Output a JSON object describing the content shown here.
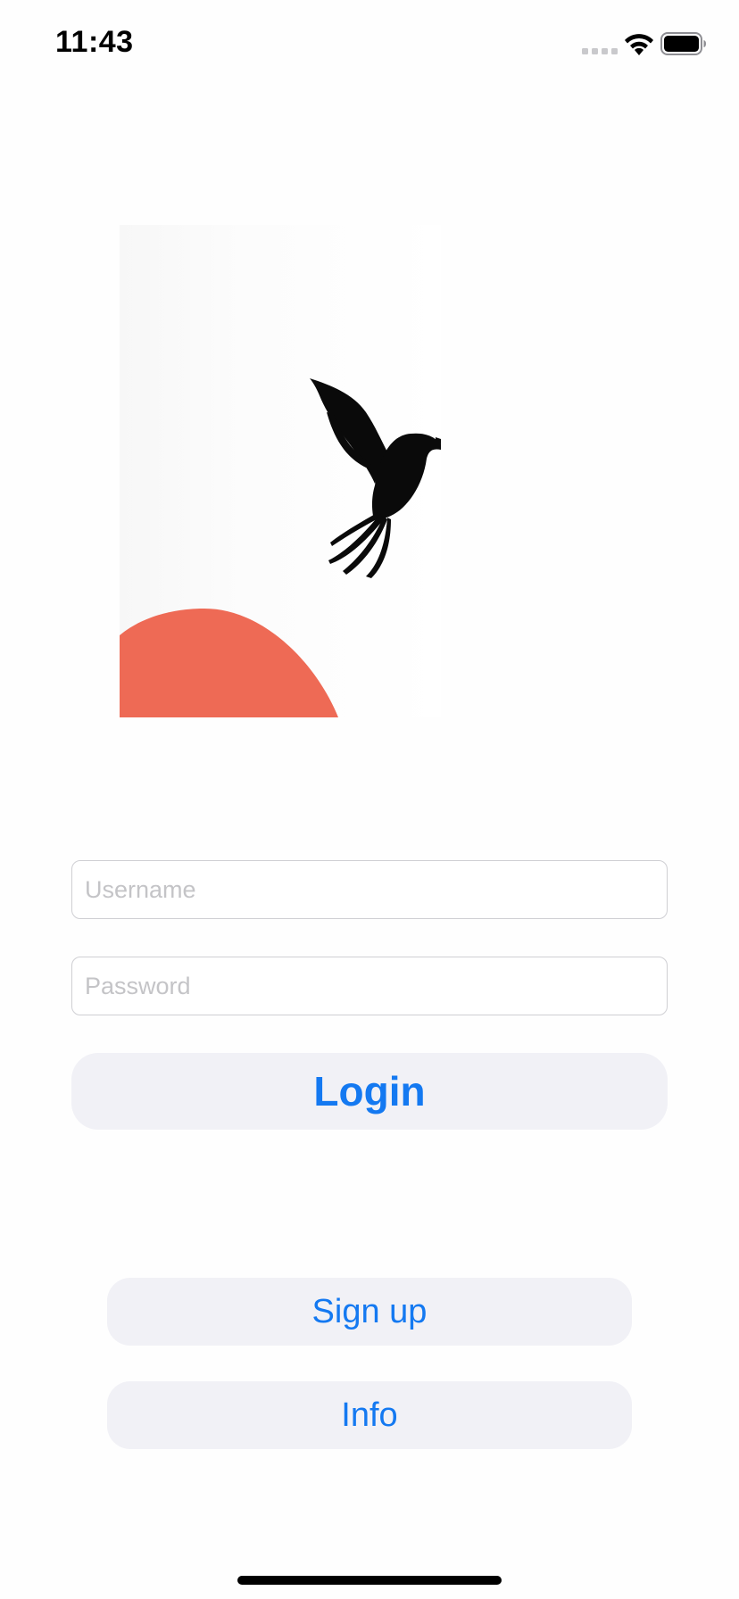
{
  "status_bar": {
    "time": "11:43",
    "signal_icon": "cellular-signal-icon",
    "wifi_icon": "wifi-icon",
    "battery_icon": "battery-full-icon"
  },
  "hero": {
    "image": "bird-over-red-sun-illustration",
    "colors": {
      "sun": "#EE6A55",
      "bird": "#000000"
    }
  },
  "form": {
    "username": {
      "placeholder": "Username",
      "value": ""
    },
    "password": {
      "placeholder": "Password",
      "value": ""
    },
    "login_label": "Login"
  },
  "secondary": {
    "signup_label": "Sign up",
    "info_label": "Info"
  },
  "colors": {
    "accent": "#1479F1",
    "button_bg": "#F1F1F6",
    "field_border": "#CFCFD3"
  }
}
